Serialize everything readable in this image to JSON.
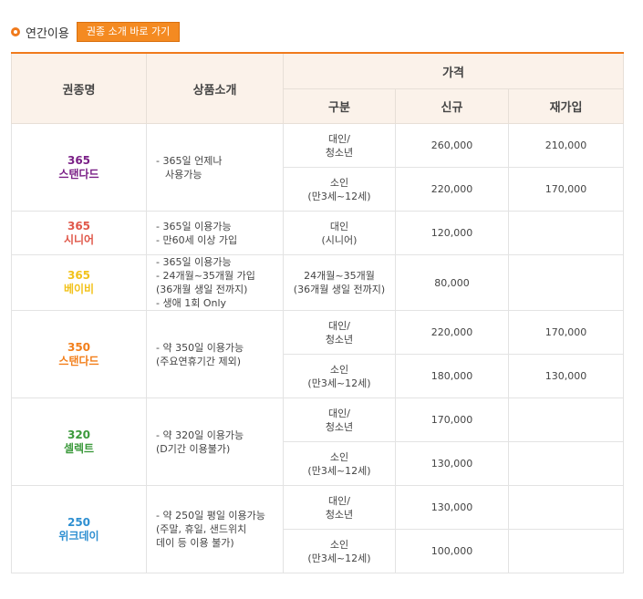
{
  "header": {
    "title": "연간이용",
    "button_label": "권종 소개 바로 가기"
  },
  "table": {
    "headers": {
      "name": "권종명",
      "intro": "상품소개",
      "price": "가격",
      "category": "구분",
      "new": "신규",
      "renew": "재가입"
    },
    "products": [
      {
        "name_num": "365",
        "name_text": "스탠다드",
        "color": "#7a1f86",
        "desc": [
          "- 365일 언제나",
          "  사용가능"
        ],
        "rows": [
          {
            "cat": [
              "대인/",
              "청소년"
            ],
            "new": "260,000",
            "renew": "210,000"
          },
          {
            "cat": [
              "소인",
              "(만3세~12세)"
            ],
            "new": "220,000",
            "renew": "170,000"
          }
        ]
      },
      {
        "name_num": "365",
        "name_text": "시니어",
        "color": "#e0584a",
        "desc": [
          "- 365일 이용가능",
          "- 만60세 이상 가입"
        ],
        "rows": [
          {
            "cat": [
              "대인",
              "(시니어)"
            ],
            "new": "120,000",
            "renew": ""
          }
        ]
      },
      {
        "name_num": "365",
        "name_text": "베이비",
        "color": "#f2c21b",
        "desc": [
          "- 365일 이용가능",
          "- 24개월~35개월 가입",
          "(36개월 생일 전까지)",
          "- 생애 1회 Only"
        ],
        "rows": [
          {
            "cat": [
              "24개월~35개월",
              "(36개월 생일 전까지)"
            ],
            "new": "80,000",
            "renew": ""
          }
        ]
      },
      {
        "name_num": "350",
        "name_text": "스탠다드",
        "color": "#f27f1b",
        "desc": [
          "- 약 350일 이용가능",
          "(주요연휴기간 제외)"
        ],
        "rows": [
          {
            "cat": [
              "대인/",
              "청소년"
            ],
            "new": "220,000",
            "renew": "170,000"
          },
          {
            "cat": [
              "소인",
              "(만3세~12세)"
            ],
            "new": "180,000",
            "renew": "130,000"
          }
        ]
      },
      {
        "name_num": "320",
        "name_text": "셀렉트",
        "color": "#3c9a3c",
        "desc": [
          "- 약 320일 이용가능",
          "(D기간 이용불가)"
        ],
        "rows": [
          {
            "cat": [
              "대인/",
              "청소년"
            ],
            "new": "170,000",
            "renew": ""
          },
          {
            "cat": [
              "소인",
              "(만3세~12세)"
            ],
            "new": "130,000",
            "renew": ""
          }
        ]
      },
      {
        "name_num": "250",
        "name_text": "위크데이",
        "color": "#2e8fd1",
        "desc": [
          "- 약 250일 평일 이용가능",
          "(주말, 휴일, 샌드위치",
          "데이 등 이용 불가)"
        ],
        "rows": [
          {
            "cat": [
              "대인/",
              "청소년"
            ],
            "new": "130,000",
            "renew": ""
          },
          {
            "cat": [
              "소인",
              "(만3세~12세)"
            ],
            "new": "100,000",
            "renew": ""
          }
        ]
      }
    ]
  }
}
